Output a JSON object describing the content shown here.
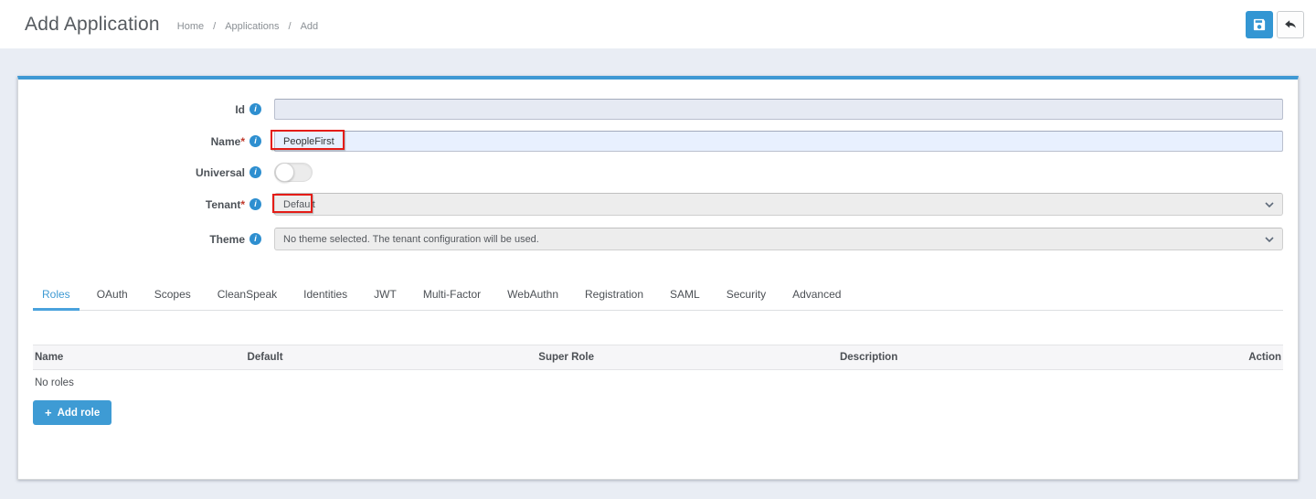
{
  "page": {
    "title": "Add Application",
    "breadcrumb": [
      "Home",
      "Applications",
      "Add"
    ],
    "breadcrumb_separator": "/"
  },
  "toolbar": {
    "save_icon": "floppy-disk-icon",
    "back_icon": "undo-arrow-icon"
  },
  "form": {
    "id": {
      "label": "Id",
      "value": ""
    },
    "name": {
      "label": "Name",
      "required_marker": "*",
      "value": "PeopleFirst"
    },
    "universal": {
      "label": "Universal",
      "state": "off"
    },
    "tenant": {
      "label": "Tenant",
      "required_marker": "*",
      "value": "Default"
    },
    "theme": {
      "label": "Theme",
      "value": "No theme selected. The tenant configuration will be used."
    }
  },
  "tabs": {
    "active": "Roles",
    "items": [
      "Roles",
      "OAuth",
      "Scopes",
      "CleanSpeak",
      "Identities",
      "JWT",
      "Multi-Factor",
      "WebAuthn",
      "Registration",
      "SAML",
      "Security",
      "Advanced"
    ]
  },
  "roles_table": {
    "columns": [
      "Name",
      "Default",
      "Super Role",
      "Description",
      "Action"
    ],
    "empty_text": "No roles",
    "add_button": {
      "icon": "plus-icon",
      "label": "Add role"
    }
  },
  "colors": {
    "accent_blue": "#3e9ad3",
    "panel_top_border": "#3f99d4",
    "save_button_bg": "#3396d3",
    "annotation_red": "#e41c17",
    "name_input_bg": "#e8f0fe",
    "id_input_bg": "#e6eaf3",
    "page_background": "#e9edf4"
  }
}
